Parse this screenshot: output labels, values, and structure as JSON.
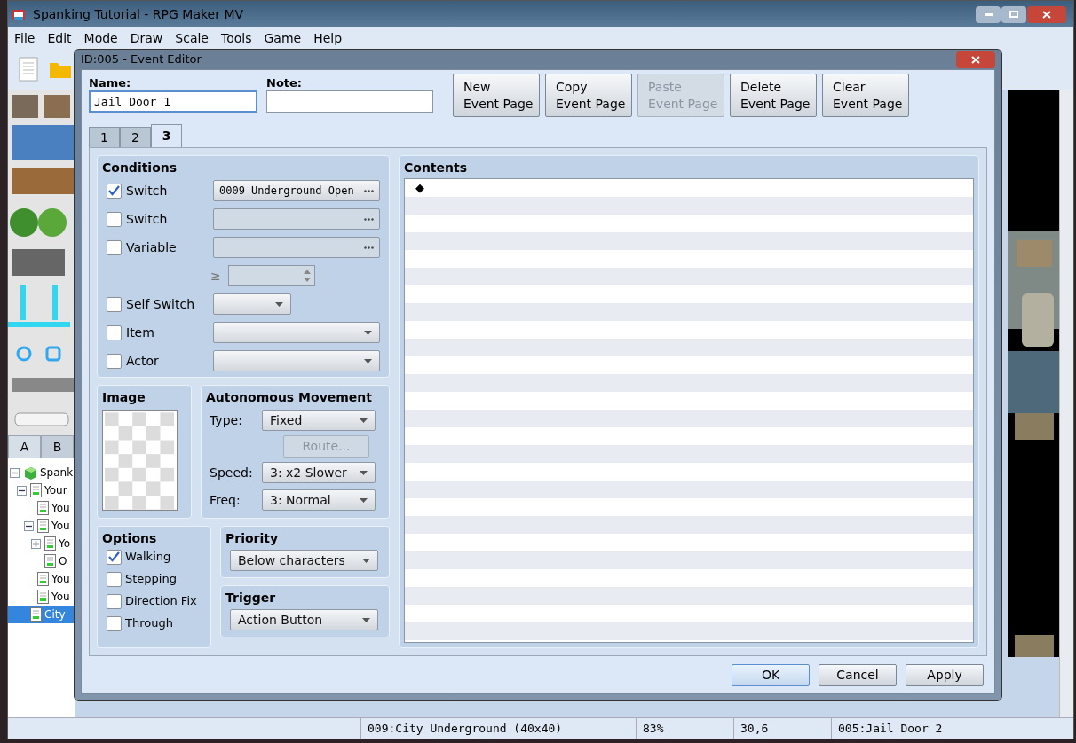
{
  "window": {
    "title": "Spanking Tutorial - RPG Maker MV"
  },
  "menu": [
    "File",
    "Edit",
    "Mode",
    "Draw",
    "Scale",
    "Tools",
    "Game",
    "Help"
  ],
  "tile_tabs": [
    {
      "label": "A",
      "selected": true
    },
    {
      "label": "B",
      "selected": false
    }
  ],
  "map_tree": [
    {
      "label": "Spank",
      "expanded": true,
      "selected": false,
      "children": [
        {
          "label": "Your",
          "expanded": true,
          "selected": false,
          "children": [
            {
              "label": "You",
              "selected": false
            },
            {
              "label": "You",
              "expanded": true,
              "selected": false,
              "children": [
                {
                  "label": "Yo",
                  "expanded": false,
                  "selected": false
                },
                {
                  "label": "O",
                  "selected": false
                }
              ]
            },
            {
              "label": "You",
              "selected": false
            },
            {
              "label": "You",
              "selected": false
            }
          ]
        },
        {
          "label": "City",
          "selected": true
        }
      ]
    }
  ],
  "status_bar": [
    "009:City Underground (40x40)",
    "83%",
    "30,6",
    "005:Jail Door 2"
  ],
  "dialog": {
    "title": "ID:005 - Event Editor",
    "name_label": "Name:",
    "name_value": "Jail Door 1",
    "note_label": "Note:",
    "page_buttons": [
      {
        "label": "New\nEvent Page",
        "disabled": false
      },
      {
        "label": "Copy\nEvent Page",
        "disabled": false
      },
      {
        "label": "Paste\nEvent Page",
        "disabled": true
      },
      {
        "label": "Delete\nEvent Page",
        "disabled": false
      },
      {
        "label": "Clear\nEvent Page",
        "disabled": false
      }
    ],
    "page_tabs": [
      {
        "label": "1",
        "selected": false
      },
      {
        "label": "2",
        "selected": false
      },
      {
        "label": "3",
        "selected": true
      }
    ],
    "conditions": {
      "title": "Conditions",
      "rows": [
        {
          "kind": "picker",
          "label": "Switch",
          "checked": true,
          "value": "0009 Underground Open"
        },
        {
          "kind": "picker",
          "label": "Switch",
          "checked": false
        },
        {
          "kind": "picker",
          "label": "Variable",
          "checked": false
        },
        {
          "kind": "compare",
          "sign": "≥"
        },
        {
          "kind": "small_select",
          "label": "Self Switch",
          "checked": false
        },
        {
          "kind": "select",
          "label": "Item",
          "checked": false
        },
        {
          "kind": "select",
          "label": "Actor",
          "checked": false
        }
      ]
    },
    "image": {
      "title": "Image"
    },
    "movement": {
      "title": "Autonomous Movement",
      "type_label": "Type:",
      "type_value": "Fixed",
      "route_button": {
        "label": "Route...",
        "disabled": true
      },
      "speed_label": "Speed:",
      "speed_value": "3: x2 Slower",
      "freq_label": "Freq:",
      "freq_value": "3: Normal"
    },
    "options": {
      "title": "Options",
      "items": [
        {
          "label": "Walking",
          "checked": true
        },
        {
          "label": "Stepping",
          "checked": false
        },
        {
          "label": "Direction Fix",
          "checked": false
        },
        {
          "label": "Through",
          "checked": false
        }
      ]
    },
    "priority": {
      "title": "Priority",
      "value": "Below characters"
    },
    "trigger": {
      "title": "Trigger",
      "value": "Action Button"
    },
    "contents": {
      "title": "Contents",
      "lines": [
        "◆"
      ]
    },
    "buttons": [
      {
        "label": "OK",
        "default": true
      },
      {
        "label": "Cancel",
        "default": false
      },
      {
        "label": "Apply",
        "default": false
      }
    ]
  }
}
